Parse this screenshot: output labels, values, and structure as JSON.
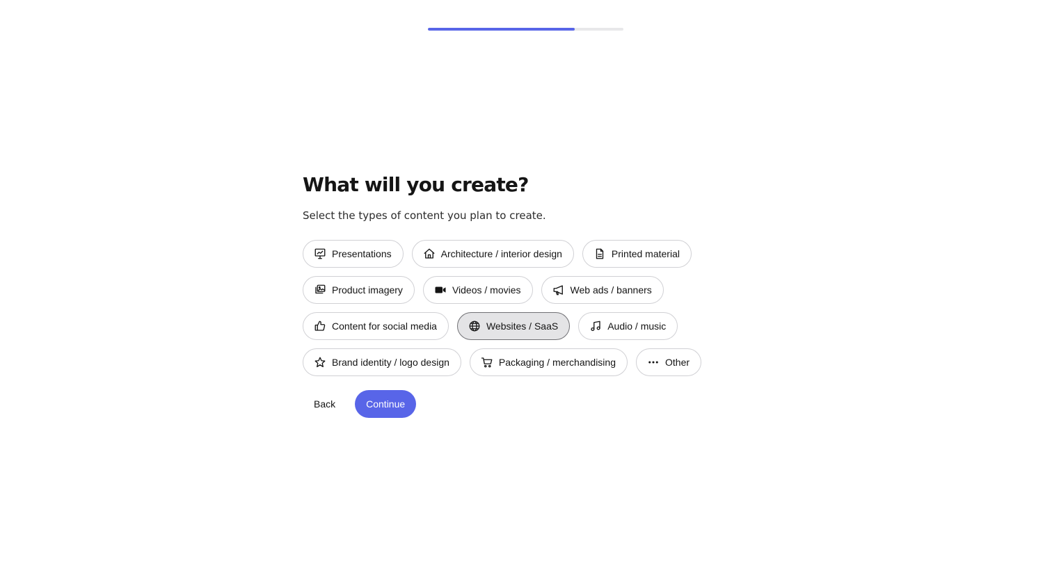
{
  "progress": {
    "value": 0.75
  },
  "colors": {
    "accent": "#5865e8",
    "selected_chip_bg": "#e4e4e6"
  },
  "heading": "What will you create?",
  "subtitle": "Select the types of content you plan to create.",
  "options": [
    {
      "label": "Presentations",
      "icon": "presentation-chart-icon",
      "selected": false
    },
    {
      "label": "Architecture / interior design",
      "icon": "home-icon",
      "selected": false
    },
    {
      "label": "Printed material",
      "icon": "document-icon",
      "selected": false
    },
    {
      "label": "Product imagery",
      "icon": "image-stack-icon",
      "selected": false
    },
    {
      "label": "Videos / movies",
      "icon": "video-camera-icon",
      "selected": false
    },
    {
      "label": "Web ads / banners",
      "icon": "megaphone-icon",
      "selected": false
    },
    {
      "label": "Content for social media",
      "icon": "thumbs-up-icon",
      "selected": false
    },
    {
      "label": "Websites / SaaS",
      "icon": "globe-icon",
      "selected": true
    },
    {
      "label": "Audio / music",
      "icon": "music-note-icon",
      "selected": false
    },
    {
      "label": "Brand identity / logo design",
      "icon": "star-icon",
      "selected": false
    },
    {
      "label": "Packaging / merchandising",
      "icon": "cart-icon",
      "selected": false
    },
    {
      "label": "Other",
      "icon": "more-dots-icon",
      "selected": false
    }
  ],
  "actions": {
    "back_label": "Back",
    "continue_label": "Continue"
  }
}
